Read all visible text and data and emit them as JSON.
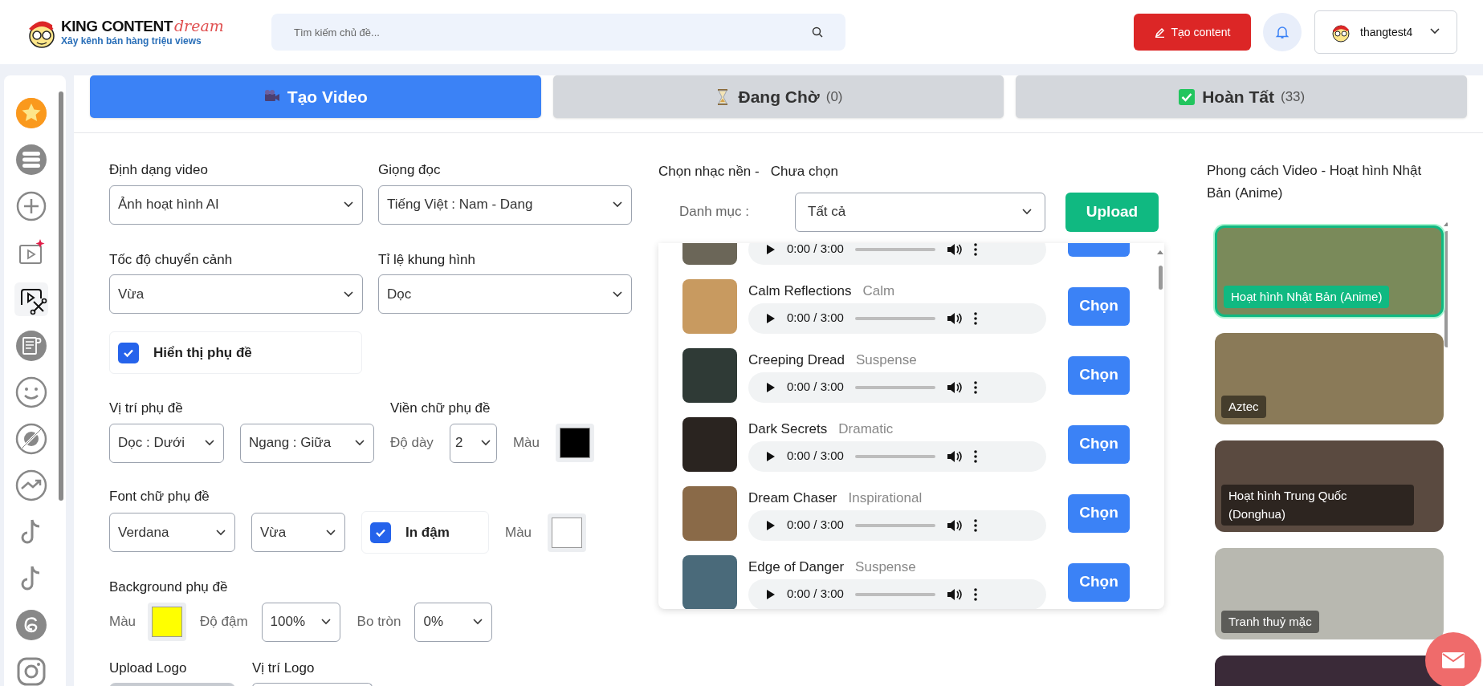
{
  "header": {
    "logo": {
      "title": "KING CONTENT",
      "script": "dream",
      "tagline": "Xây kênh bán hàng triệu views"
    },
    "search": {
      "placeholder": "Tìm kiếm chủ đề..."
    },
    "create_button": "Tạo content",
    "user": {
      "name": "thangtest4"
    }
  },
  "sidebar": {
    "items": [
      {
        "kind": "star",
        "selected": false
      },
      {
        "kind": "list",
        "selected": false
      },
      {
        "kind": "plus",
        "selected": false
      },
      {
        "kind": "video-spark",
        "selected": false
      },
      {
        "kind": "video-cut",
        "selected": true
      },
      {
        "kind": "document",
        "selected": false
      },
      {
        "kind": "smile",
        "selected": false
      },
      {
        "kind": "ad",
        "selected": false
      },
      {
        "kind": "trend",
        "selected": false
      },
      {
        "kind": "tiktok",
        "selected": false
      },
      {
        "kind": "tiktok",
        "selected": false
      },
      {
        "kind": "threads",
        "selected": false
      },
      {
        "kind": "camera",
        "selected": false
      }
    ]
  },
  "tabs": [
    {
      "kind": "camera",
      "label": "Tạo Video",
      "selected": true
    },
    {
      "kind": "hourglass",
      "label": "Đang Chờ",
      "count": "(0)",
      "selected": false
    },
    {
      "kind": "check",
      "label": "Hoàn Tất",
      "count": "(33)",
      "selected": false
    }
  ],
  "form": {
    "video_format": {
      "label": "Định dạng video",
      "value": "Ảnh hoạt hình AI"
    },
    "voice": {
      "label": "Giọng đọc",
      "value": "Tiếng Việt : Nam - Dang"
    },
    "transition_speed": {
      "label": "Tốc độ chuyển cảnh",
      "value": "Vừa"
    },
    "aspect_ratio": {
      "label": "Tỉ lệ khung hình",
      "value": "Dọc"
    },
    "show_subtitles": {
      "label": "Hiển thị phụ đề",
      "checked": true
    },
    "subtitle_position": {
      "label": "Vị trí phụ đề",
      "vertical": "Dọc : Dưới",
      "horizontal": "Ngang : Giữa"
    },
    "subtitle_outline": {
      "label": "Viền chữ phụ đề",
      "thickness_label": "Độ dày",
      "thickness": "2",
      "color_label": "Màu",
      "color": "#000000"
    },
    "subtitle_font": {
      "label": "Font chữ phụ đề",
      "font": "Verdana",
      "size": "Vừa",
      "bold_label": "In đậm",
      "bold": true,
      "color_label": "Màu",
      "color": "#ffffff"
    },
    "subtitle_background": {
      "label": "Background phụ đề",
      "color_label": "Màu",
      "color": "#ffff00",
      "opacity_label": "Độ đậm",
      "opacity": "100%",
      "radius_label": "Bo tròn",
      "radius": "0%"
    },
    "logo": {
      "upload_label": "Upload Logo",
      "position_label": "Vị trí Logo"
    }
  },
  "music": {
    "title": "Chọn nhạc nền -",
    "status": "Chưa chọn",
    "category_label": "Danh mục :",
    "category": "Tất cả",
    "upload_button": "Upload",
    "tracks": [
      {
        "time": "0:00 / 3:00"
      },
      {
        "title": "Calm Reflections",
        "genre": "Calm",
        "time": "0:00 / 3:00",
        "button": "Chọn"
      },
      {
        "title": "Creeping Dread",
        "genre": "Suspense",
        "time": "0:00 / 3:00",
        "button": "Chọn"
      },
      {
        "title": "Dark Secrets",
        "genre": "Dramatic",
        "time": "0:00 / 3:00",
        "button": "Chọn"
      },
      {
        "title": "Dream Chaser",
        "genre": "Inspirational",
        "time": "0:00 / 3:00",
        "button": "Chọn"
      },
      {
        "title": "Edge of Danger",
        "genre": "Suspense",
        "time": "0:00 / 3:00",
        "button": "Chọn"
      }
    ]
  },
  "styles": {
    "title": "Phong cách Video - Hoạt hình Nhật Bản (Anime)",
    "items": [
      {
        "label": "Hoạt hình Nhật Bản (Anime)",
        "selected": true
      },
      {
        "label": "Aztec",
        "selected": false
      },
      {
        "label": "Hoạt hình Trung Quốc (Donghua)",
        "selected": false
      },
      {
        "label": "Tranh thuỷ mặc",
        "selected": false
      },
      {
        "selected": false
      }
    ]
  }
}
